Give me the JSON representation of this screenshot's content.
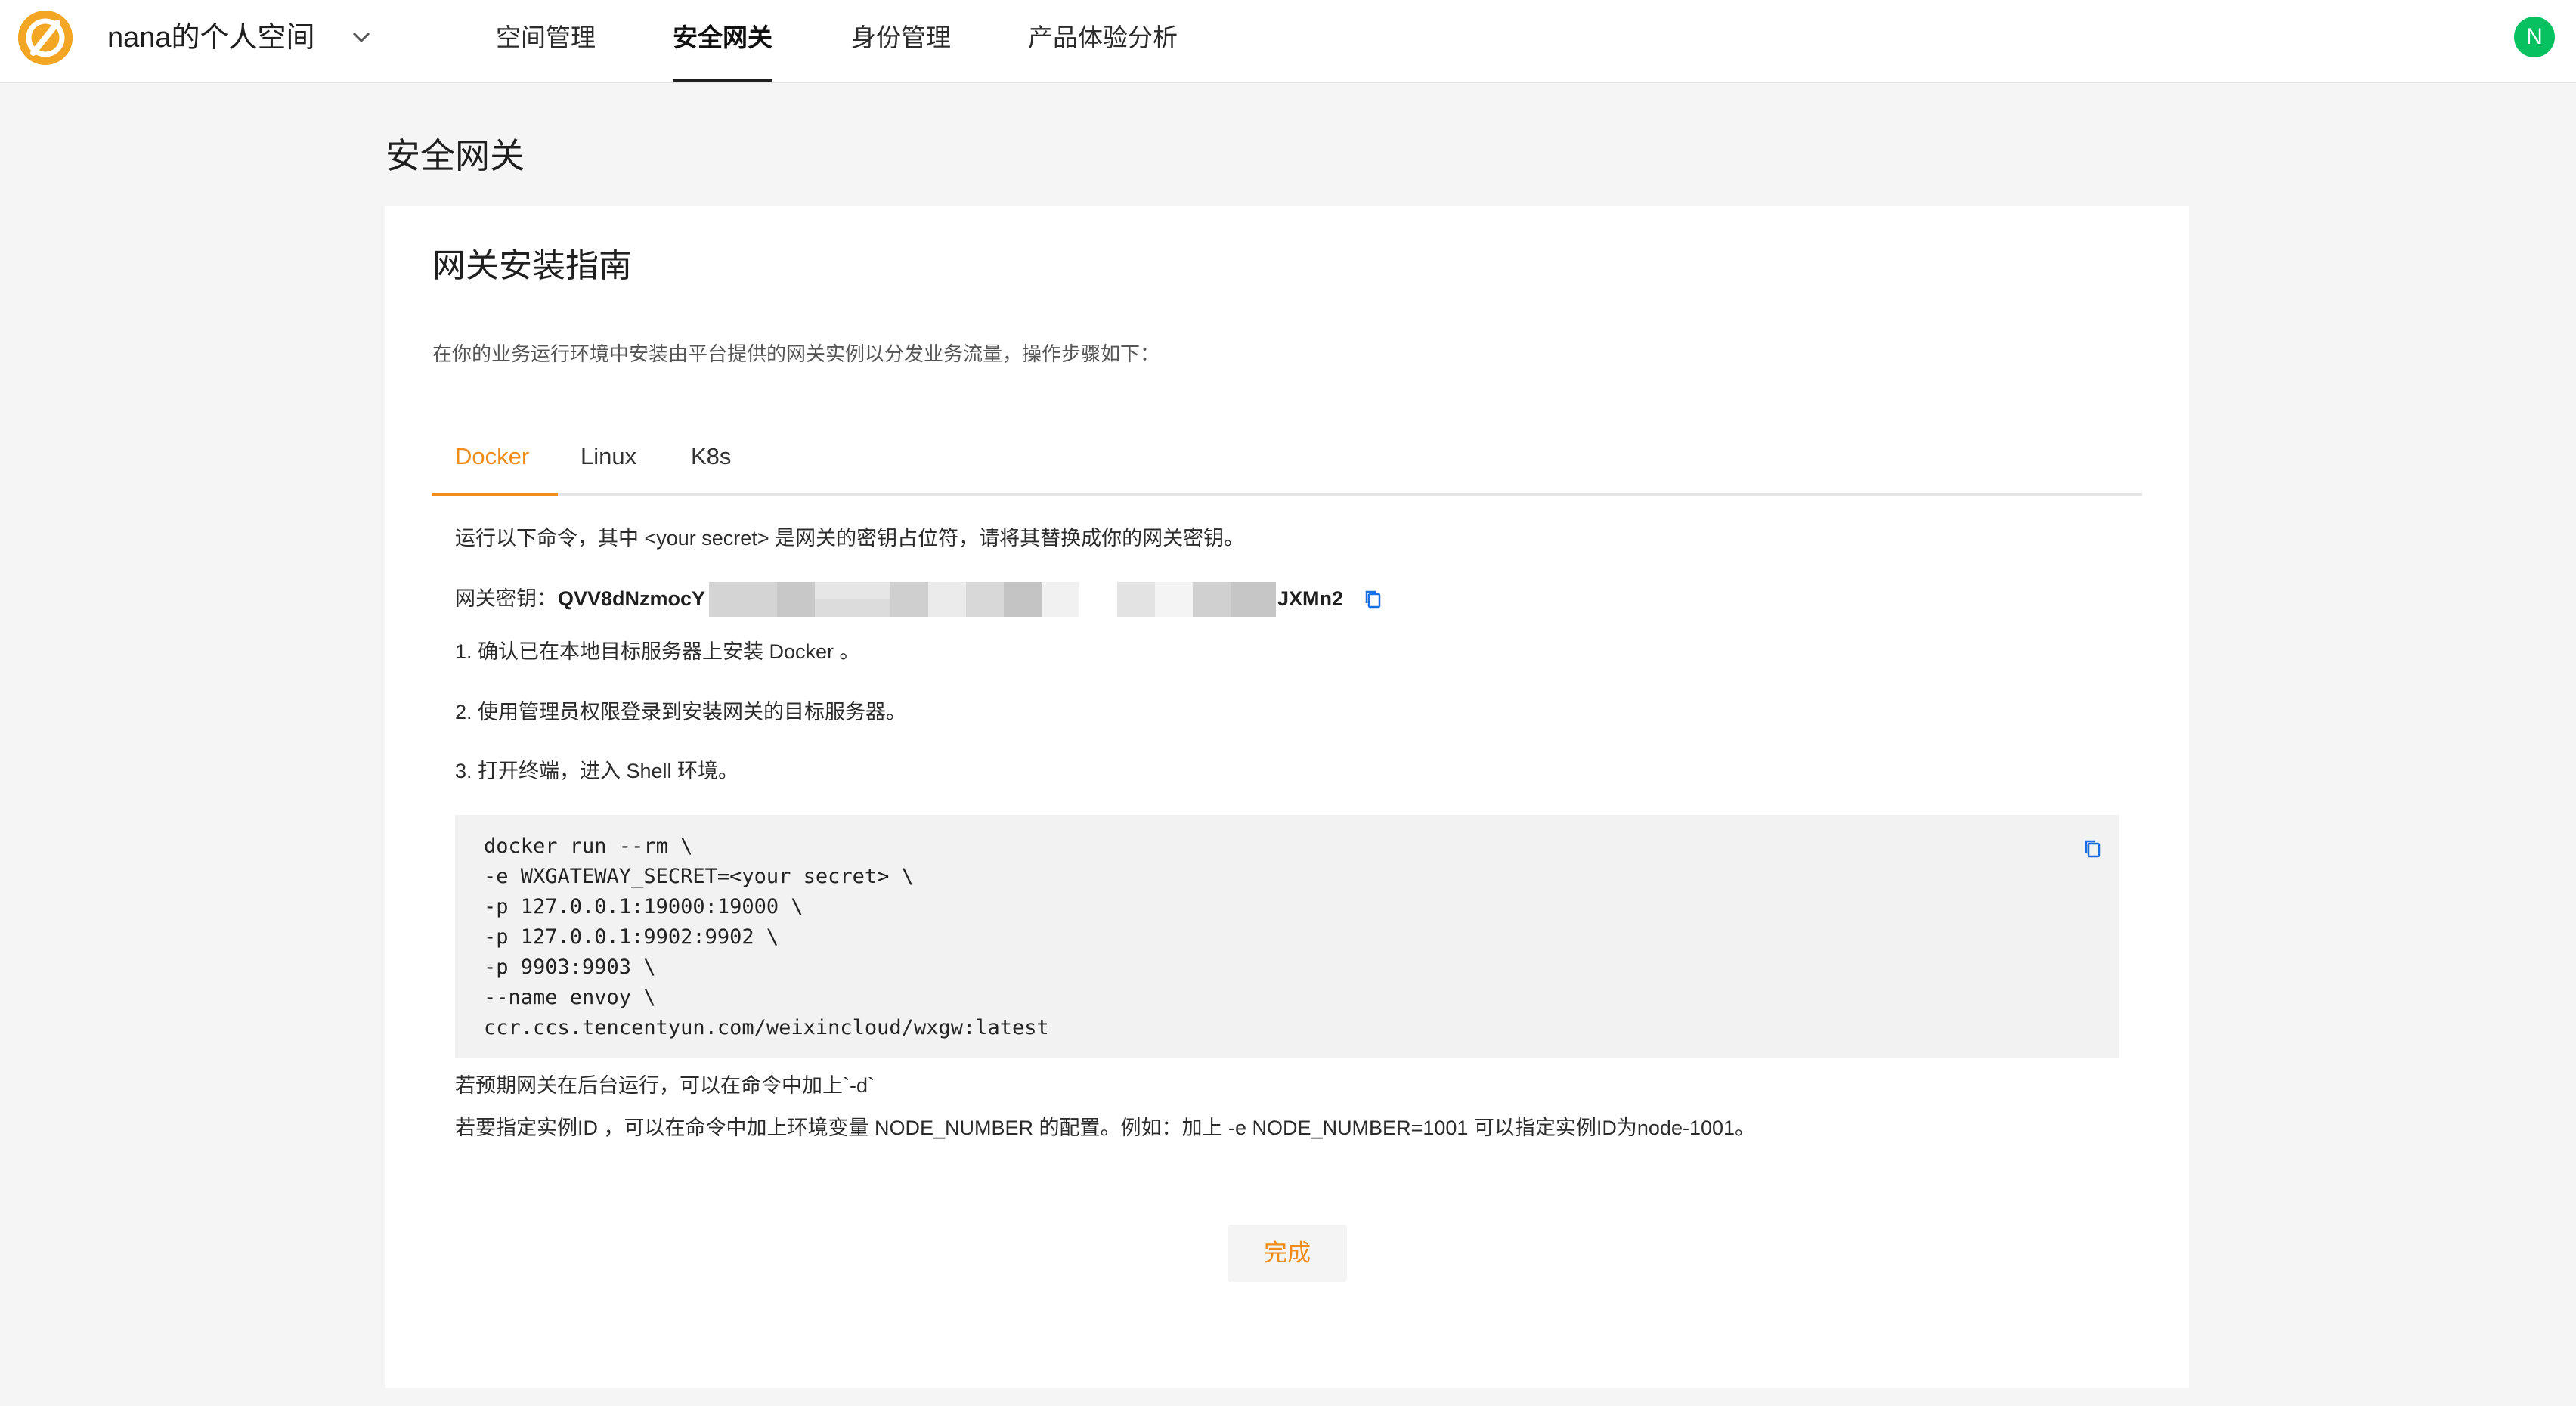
{
  "header": {
    "space_name": "nana的个人空间",
    "nav": [
      {
        "label": "空间管理"
      },
      {
        "label": "安全网关"
      },
      {
        "label": "身份管理"
      },
      {
        "label": "产品体验分析"
      }
    ],
    "active_nav": "安全网关",
    "avatar_initial": "N"
  },
  "page": {
    "title": "安全网关"
  },
  "guide": {
    "title": "网关安装指南",
    "description": "在你的业务运行环境中安装由平台提供的网关实例以分发业务流量，操作步骤如下：",
    "tabs": [
      {
        "label": "Docker"
      },
      {
        "label": "Linux"
      },
      {
        "label": "K8s"
      }
    ],
    "active_tab": "Docker",
    "intro": "运行以下命令，其中 <your secret> 是网关的密钥占位符，请将其替换成你的网关密钥。",
    "secret": {
      "label": "网关密钥：",
      "prefix": "QVV8dNzmocY",
      "suffix": "JXMn2"
    },
    "steps": [
      "1. 确认已在本地目标服务器上安装 Docker 。",
      "2. 使用管理员权限登录到安装网关的目标服务器。",
      "3. 打开终端，进入 Shell 环境。"
    ],
    "code_lines": [
      "docker run --rm \\",
      "-e WXGATEWAY_SECRET=<your secret> \\",
      "-p 127.0.0.1:19000:19000 \\",
      "-p 127.0.0.1:9902:9902 \\",
      "-p 9903:9903 \\",
      "--name envoy \\",
      "ccr.ccs.tencentyun.com/weixincloud/wxgw:latest"
    ],
    "notes": [
      "若预期网关在后台运行，可以在命令中加上`-d`",
      "若要指定实例ID ，可以在命令中加上环境变量 NODE_NUMBER 的配置。例如：加上 -e NODE_NUMBER=1001 可以指定实例ID为node-1001。"
    ],
    "done_label": "完成"
  },
  "colors": {
    "accent": "#f08c1a",
    "logo": "#f3a623",
    "avatar": "#07c160",
    "copy_icon": "#1a6fe0"
  }
}
